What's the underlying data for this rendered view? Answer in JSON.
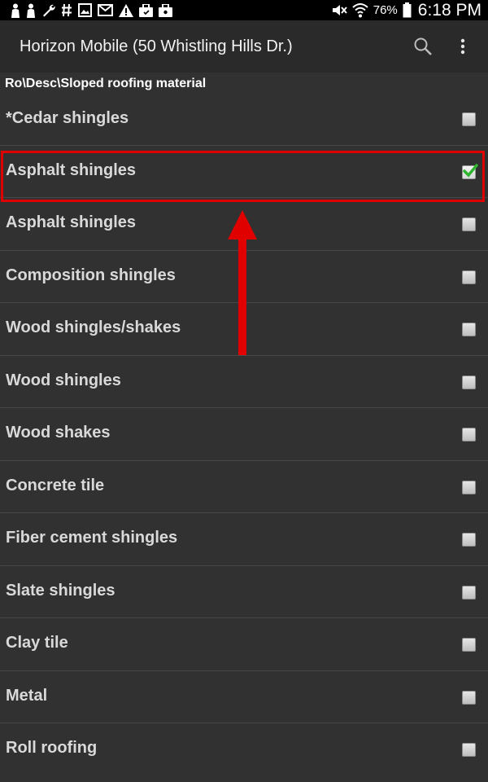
{
  "status_bar": {
    "battery_percent": "76%",
    "time": "6:18 PM",
    "icons": [
      "person-icon",
      "person-icon",
      "wrench-icon",
      "hash-icon",
      "image-icon",
      "gmail-icon",
      "warning-icon",
      "briefcase-icon",
      "briefcase-icon",
      "mute-icon",
      "wifi-icon",
      "battery-icon"
    ]
  },
  "action_bar": {
    "title": "Horizon Mobile (50 Whistling Hills Dr.)",
    "search_icon": "search-icon",
    "overflow_icon": "overflow-menu-icon"
  },
  "breadcrumb": "Ro\\Desc\\Sloped roofing material",
  "items": [
    {
      "label": "*Cedar shingles",
      "checked": false
    },
    {
      "label": "Asphalt shingles",
      "checked": true
    },
    {
      "label": "Asphalt shingles",
      "checked": false
    },
    {
      "label": "Composition shingles",
      "checked": false
    },
    {
      "label": "Wood shingles/shakes",
      "checked": false
    },
    {
      "label": "Wood shingles",
      "checked": false
    },
    {
      "label": "Wood shakes",
      "checked": false
    },
    {
      "label": "Concrete tile",
      "checked": false
    },
    {
      "label": "Fiber cement shingles",
      "checked": false
    },
    {
      "label": "Slate shingles",
      "checked": false
    },
    {
      "label": "Clay tile",
      "checked": false
    },
    {
      "label": "Metal",
      "checked": false
    },
    {
      "label": "Roll roofing",
      "checked": false
    }
  ],
  "colors": {
    "background": "#313131",
    "action_bar": "#2a2a2a",
    "highlight": "#e00000",
    "check_green": "#2fb52f"
  }
}
